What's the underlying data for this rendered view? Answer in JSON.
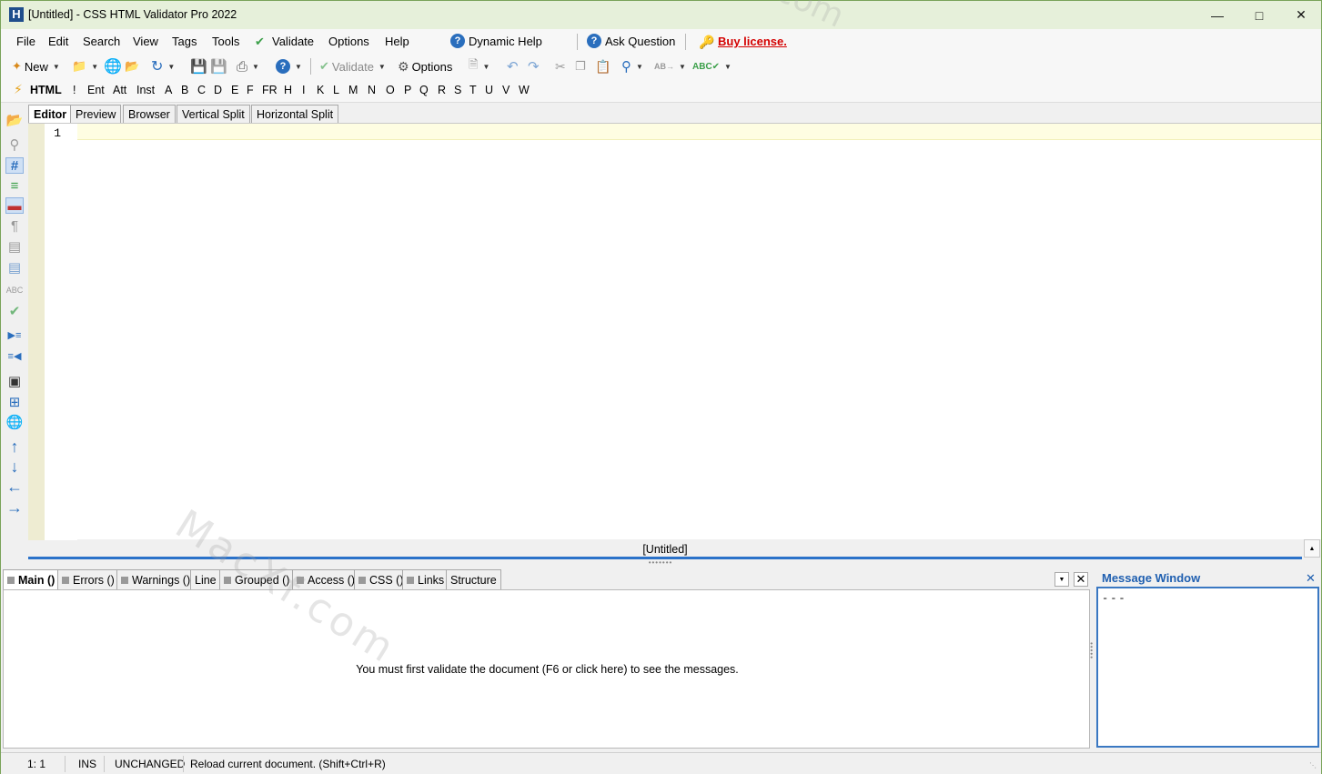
{
  "window": {
    "title": "[Untitled] - CSS HTML Validator Pro 2022",
    "app_icon_letter": "H"
  },
  "menu": {
    "items": [
      "File",
      "Edit",
      "Search",
      "View",
      "Tags",
      "Tools",
      "Validate",
      "Options",
      "Help",
      "Dynamic Help",
      "Ask Question"
    ],
    "buy_license": "Buy license."
  },
  "toolbar": {
    "new": "New",
    "validate": "Validate",
    "options": "Options"
  },
  "tagbar": {
    "html": "HTML",
    "items": [
      "!",
      "Ent",
      "Att",
      "Inst",
      "A",
      "B",
      "C",
      "D",
      "E",
      "F",
      "FR",
      "H",
      "I",
      "K",
      "L",
      "M",
      "N",
      "O",
      "P",
      "Q",
      "R",
      "S",
      "T",
      "U",
      "V",
      "W"
    ]
  },
  "editor_tabs": [
    "Editor",
    "Preview",
    "Browser",
    "Vertical Split",
    "Horizontal Split"
  ],
  "editor": {
    "line_number": "1",
    "document_name": "[Untitled]"
  },
  "bottom_tabs": [
    "Main ()",
    "Errors ()",
    "Warnings ()",
    "Line",
    "Grouped ()",
    "Access ()",
    "CSS ()",
    "Links",
    "Structure"
  ],
  "messages": {
    "text": "You must first validate the document (F6 or click here) to see the messages."
  },
  "message_window": {
    "title": "Message Window",
    "content": "---"
  },
  "status": {
    "position": "1: 1",
    "mode": "INS",
    "state": "UNCHANGED",
    "hint": "Reload current document. (Shift+Ctrl+R)"
  },
  "watermark": {
    "text": "MacXf.com",
    "text2": ".com"
  },
  "colors": {
    "accent": "#2b72c9",
    "buy_license": "#d40000",
    "titlebar": "#e6f0da",
    "gutter": "#eeecd2",
    "current_line": "#fefde2"
  }
}
